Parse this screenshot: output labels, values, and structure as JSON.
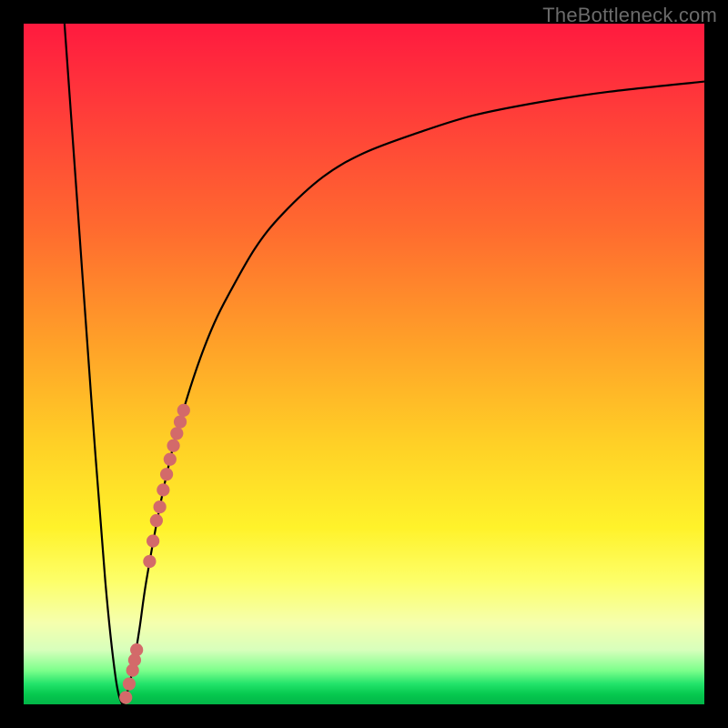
{
  "watermark": "TheBottleneck.com",
  "colors": {
    "frame": "#000000",
    "gradient_top": "#ff1a3f",
    "gradient_bottom": "#02b547",
    "curve_stroke": "#000000",
    "dot_fill": "#d36a6a"
  },
  "chart_data": {
    "type": "line",
    "title": "",
    "xlabel": "",
    "ylabel": "",
    "xlim": [
      0,
      100
    ],
    "ylim": [
      0,
      100
    ],
    "series": [
      {
        "name": "bottleneck-curve",
        "x": [
          6,
          8,
          10,
          12,
          13.5,
          14.5,
          15,
          16,
          17,
          18,
          20,
          22,
          24,
          26,
          28,
          30,
          34,
          38,
          44,
          50,
          58,
          66,
          76,
          86,
          100
        ],
        "y": [
          100,
          72,
          44,
          18,
          4,
          0,
          1,
          5,
          11,
          18,
          29,
          38,
          45,
          51,
          56,
          60,
          67,
          72,
          77.5,
          81,
          84,
          86.5,
          88.5,
          90,
          91.5
        ]
      }
    ],
    "scatter_overlay": {
      "name": "highlight-dots",
      "description": "clustered points along rising portion of curve near the minimum",
      "points": [
        {
          "x": 15.0,
          "y": 1.0
        },
        {
          "x": 15.5,
          "y": 3.0
        },
        {
          "x": 16.0,
          "y": 5.0
        },
        {
          "x": 16.3,
          "y": 6.5
        },
        {
          "x": 16.6,
          "y": 8.0
        },
        {
          "x": 18.5,
          "y": 21.0
        },
        {
          "x": 19.0,
          "y": 24.0
        },
        {
          "x": 19.5,
          "y": 27.0
        },
        {
          "x": 20.0,
          "y": 29.0
        },
        {
          "x": 20.5,
          "y": 31.5
        },
        {
          "x": 21.0,
          "y": 33.8
        },
        {
          "x": 21.5,
          "y": 36.0
        },
        {
          "x": 22.0,
          "y": 38.0
        },
        {
          "x": 22.5,
          "y": 39.8
        },
        {
          "x": 23.0,
          "y": 41.5
        },
        {
          "x": 23.5,
          "y": 43.2
        }
      ]
    }
  }
}
